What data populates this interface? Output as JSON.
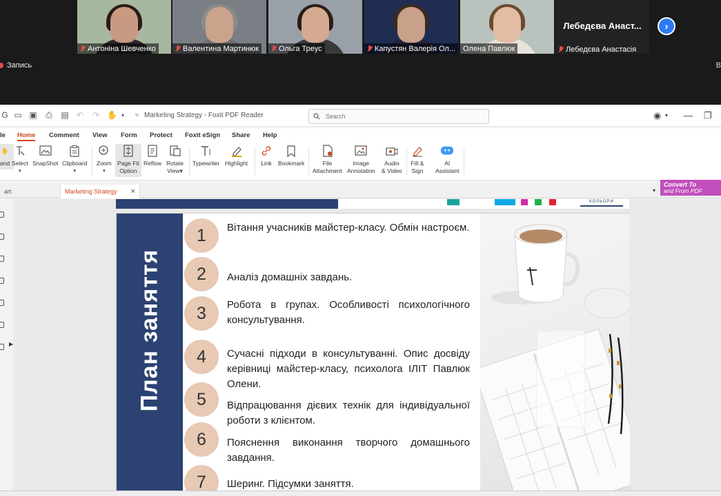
{
  "meeting": {
    "participants": [
      {
        "name": "Антоніна Шевченко",
        "muted": true,
        "bg": "#a7b7a0",
        "face": "#c89a82",
        "hair": "#2a1c18",
        "shirt": "#2a2a2a"
      },
      {
        "name": "Валентина Мартинюк",
        "muted": true,
        "bg": "#7a7f86",
        "face": "#caa38d",
        "hair": "#8c8c88",
        "shirt": "#6f6f6f"
      },
      {
        "name": "Ольга Треус",
        "muted": true,
        "bg": "#9aa0a8",
        "face": "#d4ab92",
        "hair": "#2a1d18",
        "shirt": "#3a3a3a"
      },
      {
        "name": "Капустян Валерія Ол...",
        "muted": true,
        "bg": "#1f2d52",
        "face": "#c9a08a",
        "hair": "#3b2a22",
        "shirt": "#26233a"
      },
      {
        "name": "Олена Павлюк",
        "muted": false,
        "active": true,
        "bg": "#b9c2bd",
        "face": "#e3bca4",
        "hair": "#6b4a2f",
        "shirt": "#e7e2da"
      }
    ],
    "name_only_tile": {
      "display": "Лебедєва Анаст...",
      "label": "Лебедєва Анастасія"
    },
    "record_label": "Запись",
    "edge_text": "В"
  },
  "titlebar": {
    "doc_title": "Marketing Strategy - Foxit PDF Reader",
    "search_placeholder": "Search"
  },
  "menu": [
    "le",
    "Home",
    "Comment",
    "View",
    "Form",
    "Protect",
    "Foxit eSign",
    "Share",
    "Help"
  ],
  "ribbon": {
    "hand": "and",
    "select": "Select",
    "snapshot": "SnapShot",
    "clipboard": "Clipboard",
    "zoom": "Zoom",
    "page_fit_1": "Page Fit",
    "page_fit_2": "Option",
    "reflow": "Reflow",
    "rotate_1": "Rotate",
    "rotate_2": "View",
    "typewriter": "Typewriter",
    "highlight": "Highlight",
    "link": "Link",
    "bookmark": "Bookmark",
    "file_att_1": "File",
    "file_att_2": "Attachment",
    "img_ann_1": "Image",
    "img_ann_2": "Annotation",
    "audio_1": "Audio",
    "audio_2": "& Video",
    "fill_1": "Fill &",
    "fill_2": "Sign",
    "ai_1": "AI",
    "ai_2": "Assistant"
  },
  "tabs": {
    "prev": "art",
    "active": "Marketing Strategy"
  },
  "convert": {
    "line1": "Convert To",
    "line2": "and From PDF"
  },
  "slide": {
    "title": "План заняття",
    "logo": "КОЛЬОРИ",
    "items": [
      {
        "n": "1",
        "text": "Вітання учасників майстер-класу. Обмін настроєм."
      },
      {
        "n": "2",
        "text": "Аналіз домашніх завдань."
      },
      {
        "n": "3",
        "text": "Робота в групах. Особливості психологічного консультування."
      },
      {
        "n": "4",
        "text": "Сучасні підходи в консультуванні. Опис досвіду керівниці майстер-класу, психолога ІЛІТ Павлюк  Олени."
      },
      {
        "n": "5",
        "text": "Відпрацювання дієвих    технік    для індивідуальної роботи з клієнтом."
      },
      {
        "n": "6",
        "text": "Пояснення виконання творчого домашнього завдання."
      },
      {
        "n": "7",
        "text": "Шеринг. Підсумки заняття."
      }
    ]
  },
  "colors": {
    "navy": "#2b4272",
    "circle": "#e7c9b4",
    "accent": "#d0461f",
    "convert": "#c04fbc",
    "zoom_blue": "#2d7bf4"
  }
}
